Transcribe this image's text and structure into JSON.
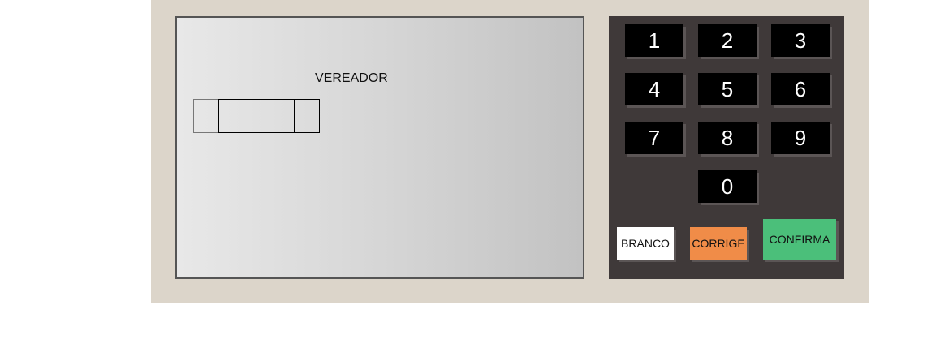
{
  "screen": {
    "office_title": "VEREADOR",
    "digit_slots": 5,
    "digits": [
      "",
      "",
      "",
      "",
      ""
    ]
  },
  "keypad": {
    "keys": [
      "1",
      "2",
      "3",
      "4",
      "5",
      "6",
      "7",
      "8",
      "9",
      "0"
    ],
    "branco_label": "BRANCO",
    "corrige_label": "CORRIGE",
    "confirma_label": "CONFIRMA"
  },
  "colors": {
    "machine_body": "#dcd5ca",
    "keypad_panel": "#3f3939",
    "key": "#000000",
    "branco": "#ffffff",
    "corrige": "#f08c48",
    "confirma": "#4bbf7a"
  }
}
